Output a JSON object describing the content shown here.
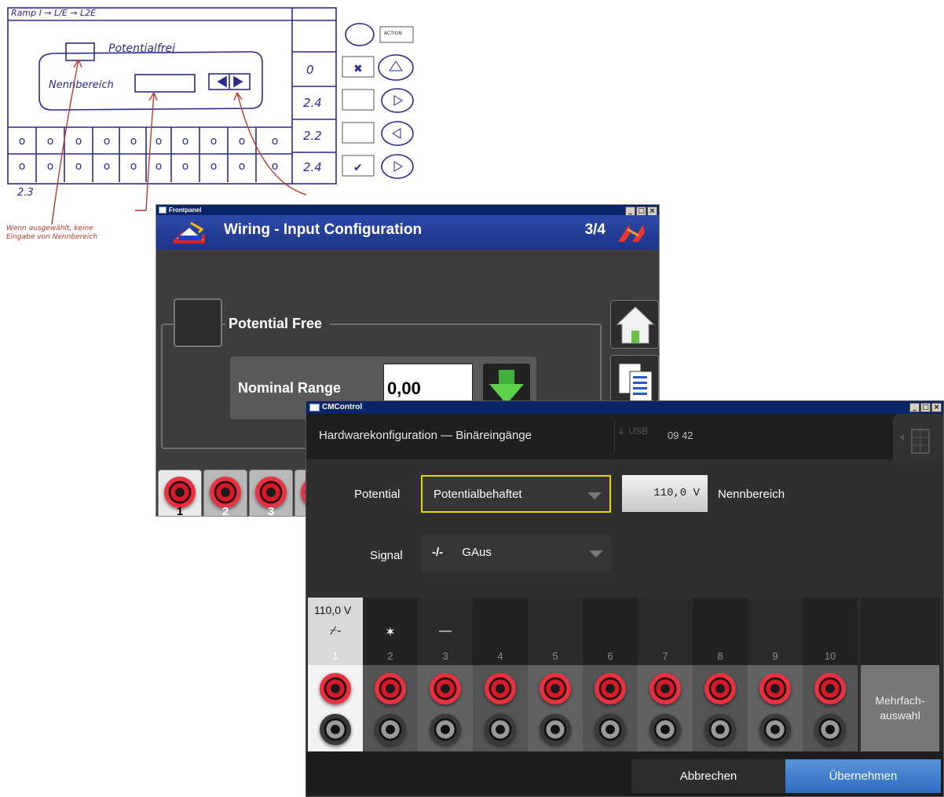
{
  "sketch": {
    "header": "Ramp      I → L/E → L2E",
    "potential_free": "Potentialfrei",
    "range_label": "Nennbereich",
    "action_button": "ACTION",
    "right_column": [
      "0",
      "2.4",
      "2.2",
      "2.4"
    ],
    "bottom_left": "2.3",
    "note": "Wenn ausgewählt, keine Eingabe von Nennbereich",
    "row_values": [
      "o",
      "o",
      "o",
      "o",
      "o",
      "o",
      "o",
      "o",
      "o",
      "o"
    ]
  },
  "frontpanel": {
    "window_title": "Frontpanel",
    "title": "Wiring - Input Configuration",
    "page": "3/4",
    "potential_free_label": "Potential Free",
    "nominal_range_label": "Nominal Range",
    "nominal_range_value": "0,00",
    "channels": [
      "1",
      "2",
      "3"
    ]
  },
  "cmcontrol": {
    "window_title": "CMControl",
    "title": "Hardwarekonfiguration — Binäreingänge",
    "usb_label": "USB",
    "time": "09 42",
    "potential_label": "Potential",
    "potential_value": "Potentialbehaftet",
    "range_value": "110,0 V",
    "range_label": "Nennbereich",
    "signal_label": "Signal",
    "signal_value": "GAus",
    "signal_icon": "-/-",
    "channel1_voltage": "110,0 V",
    "channels": [
      {
        "num": "1",
        "sig": "⌿-"
      },
      {
        "num": "2",
        "sig": "✶"
      },
      {
        "num": "3",
        "sig": "—"
      },
      {
        "num": "4",
        "sig": ""
      },
      {
        "num": "5",
        "sig": ""
      },
      {
        "num": "6",
        "sig": ""
      },
      {
        "num": "7",
        "sig": ""
      },
      {
        "num": "8",
        "sig": ""
      },
      {
        "num": "9",
        "sig": ""
      },
      {
        "num": "10",
        "sig": ""
      }
    ],
    "multi_select": "Mehrfach-\nauswahl",
    "cancel": "Abbrechen",
    "apply": "Übernehmen"
  },
  "colors": {
    "accent_blue": "#2d6cc0",
    "focus_yellow": "#e5d800",
    "jack_red": "#d61a2a",
    "titlebar_blue": "#0a246a"
  }
}
